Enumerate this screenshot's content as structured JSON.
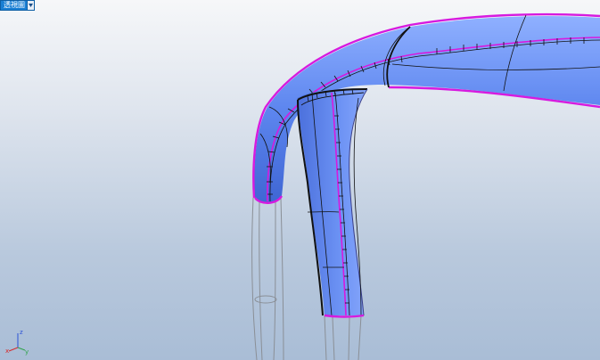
{
  "viewport": {
    "tab_label": "透視圖",
    "menu_icon": "chevron-down-icon",
    "background_top": "#f6f7f9",
    "background_bottom": "#a9bdd6"
  },
  "model": {
    "surface_color": "#5d86ef",
    "edge_color": "#d71adf",
    "wire_color": "#111111",
    "hidden_wire_color": "#8a8f96"
  },
  "axis_gizmo": {
    "x_label": "x",
    "y_label": "y",
    "z_label": "z",
    "x_color": "#d62b2b",
    "y_color": "#2fa34a",
    "z_color": "#2b52d6"
  }
}
